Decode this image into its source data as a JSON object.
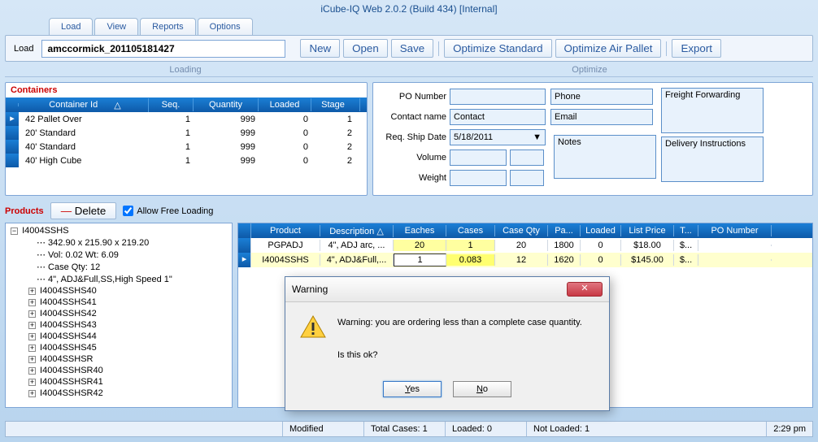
{
  "app": {
    "title": "iCube-IQ Web 2.0.2 (Build 434) [Internal]"
  },
  "menu": {
    "tabs": [
      "Load",
      "View",
      "Reports",
      "Options"
    ]
  },
  "toolbar": {
    "load_label": "Load",
    "load_value": "amccormick_201105181427",
    "new_btn": "New",
    "open_btn": "Open",
    "save_btn": "Save",
    "opt_std": "Optimize Standard",
    "opt_air": "Optimize Air Pallet",
    "export_btn": "Export",
    "section_loading": "Loading",
    "section_optimize": "Optimize"
  },
  "containers": {
    "title": "Containers",
    "headers": [
      "Container Id",
      "Seq.",
      "Quantity",
      "Loaded",
      "Stage"
    ],
    "sort_arrow": "△",
    "rows": [
      {
        "id": "42 Pallet Over",
        "seq": "1",
        "qty": "999",
        "loaded": "0",
        "stage": "1"
      },
      {
        "id": "20' Standard",
        "seq": "1",
        "qty": "999",
        "loaded": "0",
        "stage": "2"
      },
      {
        "id": "40' Standard",
        "seq": "1",
        "qty": "999",
        "loaded": "0",
        "stage": "2"
      },
      {
        "id": "40' High Cube",
        "seq": "1",
        "qty": "999",
        "loaded": "0",
        "stage": "2"
      }
    ]
  },
  "order": {
    "po_label": "PO Number",
    "contact_label": "Contact name",
    "contact_value": "Contact",
    "shipdate_label": "Req. Ship Date",
    "shipdate_value": "5/18/2011",
    "volume_label": "Volume",
    "weight_label": "Weight",
    "phone_label": "Phone",
    "email_label": "Email",
    "notes_label": "Notes",
    "freight_label": "Freight Forwarding",
    "delivery_label": "Delivery Instructions"
  },
  "products": {
    "title": "Products",
    "delete_btn": "Delete",
    "allow_free": "Allow Free Loading",
    "tree": {
      "root": "I4004SSHS",
      "specs": [
        "342.90 x 215.90 x 219.20",
        "Vol: 0.02 Wt: 6.09",
        "Case Qty: 12",
        "4\", ADJ&Full,SS,High Speed 1\""
      ],
      "children": [
        "I4004SSHS40",
        "I4004SSHS41",
        "I4004SSHS42",
        "I4004SSHS43",
        "I4004SSHS44",
        "I4004SSHS45",
        "I4004SSHSR",
        "I4004SSHSR40",
        "I4004SSHSR41",
        "I4004SSHSR42"
      ]
    },
    "grid": {
      "headers": [
        "Product",
        "Description",
        "Eaches",
        "Cases",
        "Case Qty",
        "Pa...",
        "Loaded",
        "List Price",
        "T...",
        "PO Number"
      ],
      "rows": [
        {
          "prod": "PGPADJ",
          "desc": "4\", ADJ arc, ...",
          "each": "20",
          "cases": "1",
          "cqty": "20",
          "pa": "1800",
          "load": "0",
          "list": "$18.00",
          "t": "$...",
          "po": ""
        },
        {
          "prod": "I4004SSHS",
          "desc": "4\", ADJ&Full,...",
          "each": "1",
          "cases": "0.083",
          "cqty": "12",
          "pa": "1620",
          "load": "0",
          "list": "$145.00",
          "t": "$...",
          "po": ""
        }
      ]
    }
  },
  "status": {
    "modified": "Modified",
    "total": "Total Cases: 1",
    "loaded": "Loaded: 0",
    "notloaded": "Not Loaded: 1",
    "time": "2:29 pm"
  },
  "dialog": {
    "title": "Warning",
    "line1": "Warning: you are ordering less than a complete case quantity.",
    "line2": "Is this ok?",
    "yes": "Yes",
    "no": "No"
  }
}
